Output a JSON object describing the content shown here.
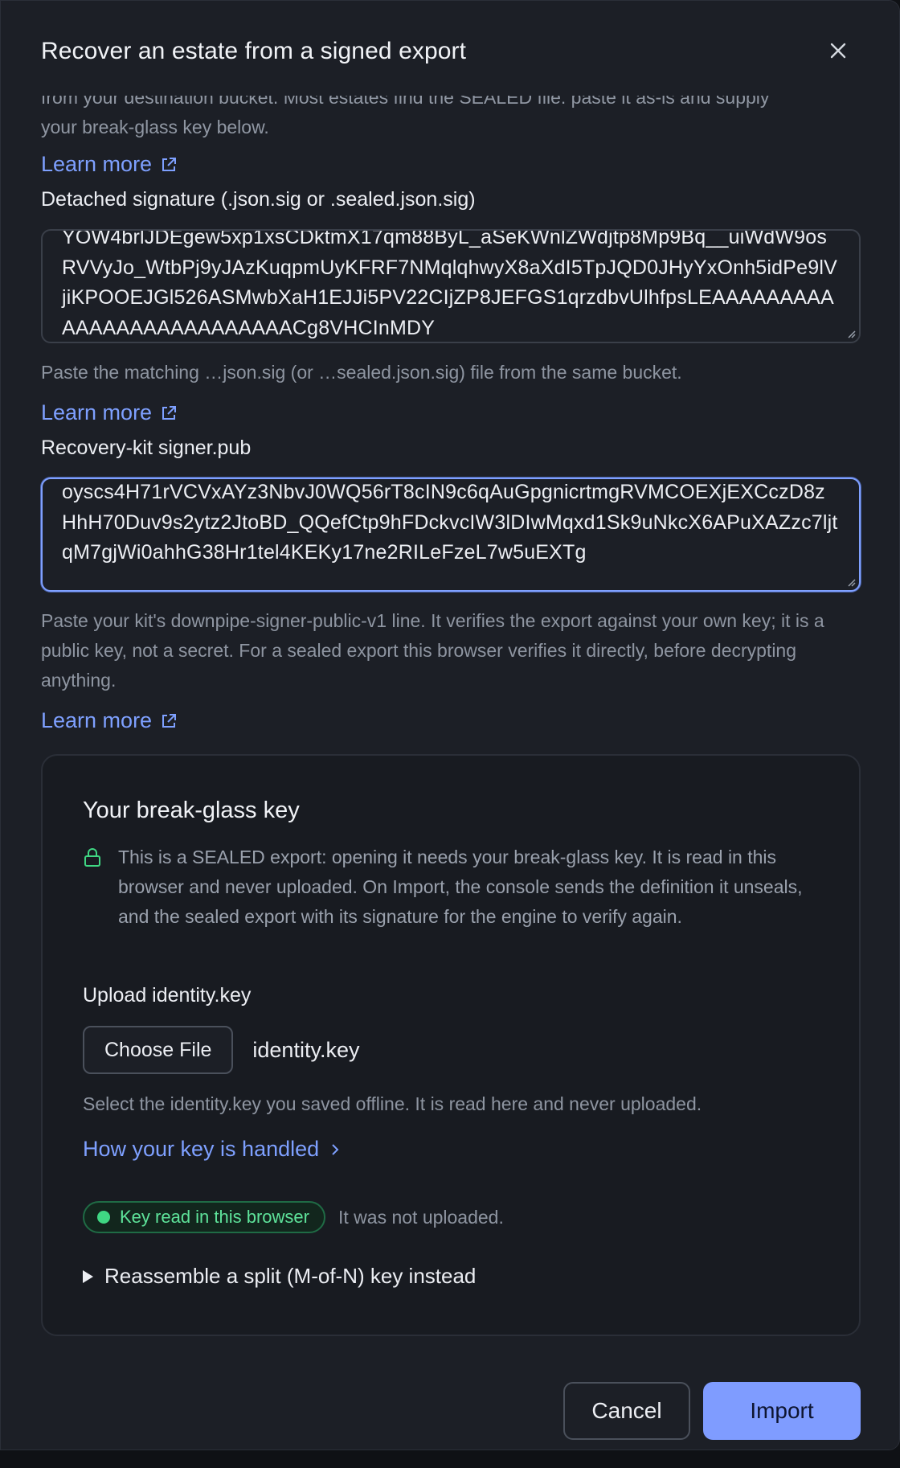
{
  "dialog": {
    "title": "Recover an estate from a signed export",
    "close_icon": "close-icon"
  },
  "intro": {
    "clipped_text": "from your destination bucket. Most estates find the SEALED file: paste it as-is and supply",
    "text_line2": "your break-glass key below.",
    "learn_more": "Learn more"
  },
  "signature": {
    "label": "Detached signature (.json.sig or .sealed.json.sig)",
    "value": "YOW4brlJDEgew5xp1xsCDktmX17qm88ByL_aSeKWnlZWdjtp8Mp9Bq__uiWdW9osRVVyJo_WtbPj9yJAzKuqpmUyKFRF7NMqlqhwyX8aXdI5TpJQD0JHyYxOnh5idPe9lVjiKPOOEJGl526ASMwbXaH1EJJi5PV22CIjZP8JEFGS1qrzdbvUlhfpsLEAAAAAAAAAAAAAAAAAAAAAAAAAACg8VHCInMDY",
    "help": "Paste the matching …json.sig (or …sealed.json.sig) file from the same bucket.",
    "learn_more": "Learn more"
  },
  "signer": {
    "label": "Recovery-kit signer.pub",
    "value": "oyscs4H71rVCVxAYz3NbvJ0WQ56rT8cIN9c6qAuGpgnicrtmgRVMCOEXjEXCczD8zHhH70Duv9s2ytz2JtoBD_QQefCtp9hFDckvcIW3lDIwMqxd1Sk9uNkcX6APuXAZzc7ljtqM7gjWi0ahhG38Hr1tel4KEKy17ne2RILeFzeL7w5uEXTg",
    "help": "Paste your kit's downpipe-signer-public-v1 line. It verifies the export against your own key; it is a public key, not a secret. For a sealed export this browser verifies it directly, before decrypting anything.",
    "learn_more": "Learn more"
  },
  "breakglass": {
    "title": "Your break-glass key",
    "note": "This is a SEALED export: opening it needs your break-glass key. It is read in this browser and never uploaded. On Import, the console sends the definition it unseals, and the sealed export with its signature for the engine to verify again.",
    "upload_label": "Upload identity.key",
    "choose_file": "Choose File",
    "file_name": "identity.key",
    "select_help": "Select the identity.key you saved offline. It is read here and never uploaded.",
    "how_handled": "How your key is handled",
    "status_badge": "Key read in this browser",
    "status_text": "It was not uploaded.",
    "split_toggle": "Reassemble a split (M-of-N) key instead"
  },
  "footer": {
    "cancel": "Cancel",
    "import": "Import"
  },
  "colors": {
    "accent": "#7f9cff",
    "link": "#7ea0ff",
    "success": "#3fd783",
    "background": "#1c1f26"
  }
}
